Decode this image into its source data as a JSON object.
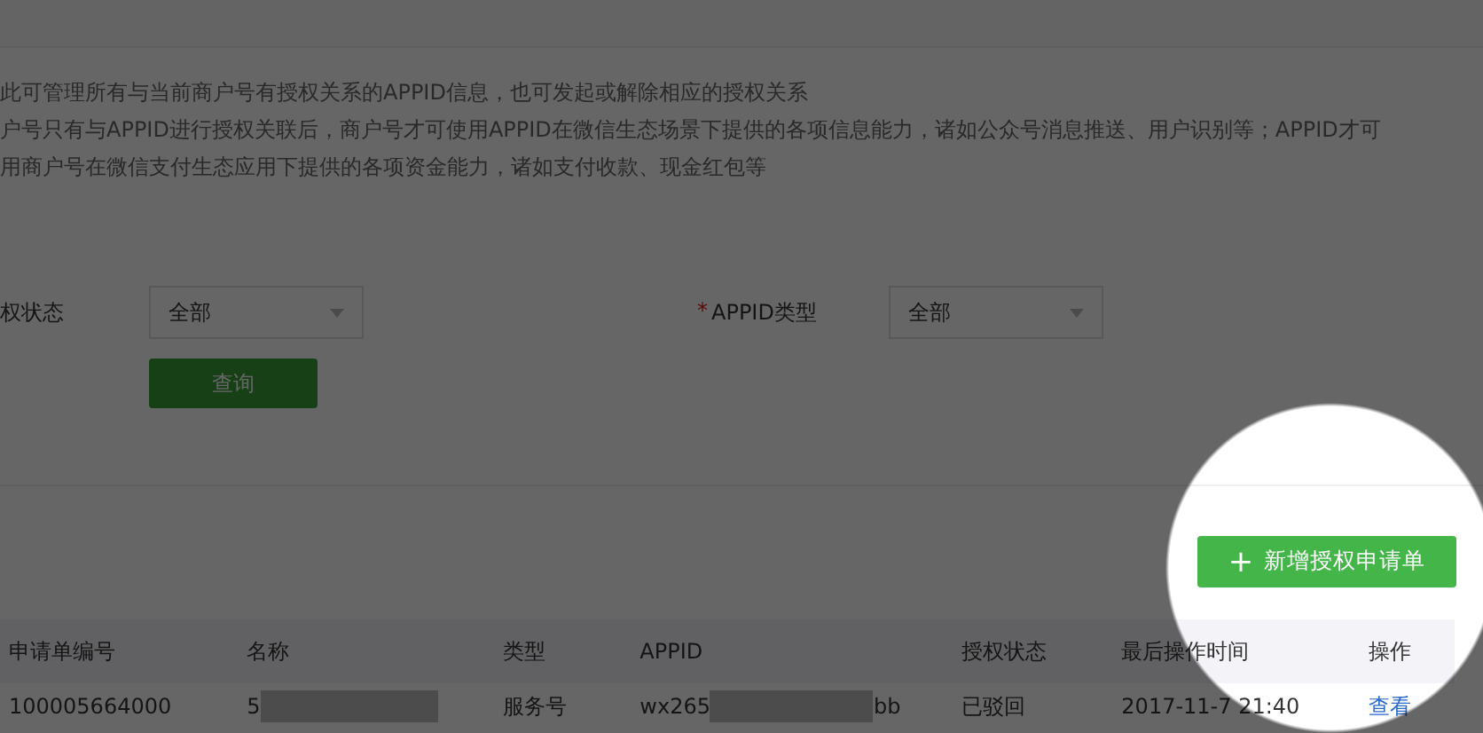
{
  "intro": [
    "此可管理所有与当前商户号有授权关系的APPID信息，也可发起或解除相应的授权关系",
    "户号只有与APPID进行授权关联后，商户号才可使用APPID在微信生态场景下提供的各项信息能力，诸如公众号消息推送、用户识别等；APPID才可",
    "用商户号在微信支付生态应用下提供的各项资金能力，诸如支付收款、现金红包等"
  ],
  "filters": [
    {
      "label": "权状态",
      "value": "全部"
    },
    {
      "mark": "*",
      "label": "APPID类型",
      "value": "全部"
    }
  ],
  "query_button": "查询",
  "add_button": {
    "icon": "+",
    "label": "新增授权申请单"
  },
  "table": {
    "columns": [
      "申请单编号",
      "名称",
      "类型",
      "APPID",
      "授权状态",
      "最后操作时间",
      "操作"
    ],
    "rows": [
      {
        "id": "100005664000",
        "name": "5",
        "type": "服务号",
        "appid_start": "wx265",
        "appid_end": "bb",
        "status": "已驳回",
        "time": "2017-11-7 21:40",
        "action": "查看"
      }
    ]
  }
}
